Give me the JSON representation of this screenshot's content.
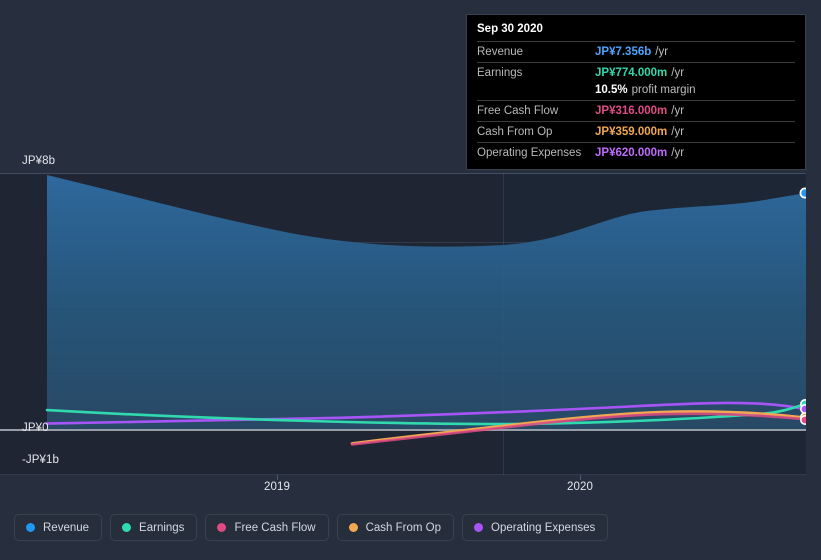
{
  "chart_data": {
    "type": "area",
    "title": "",
    "xlabel": "",
    "ylabel": "",
    "currency": "JP¥",
    "ylim": [
      -1000000000,
      8000000000
    ],
    "yticks": [
      {
        "value": 8000000000,
        "label": "JP¥8b"
      },
      {
        "value": 0,
        "label": "JP¥0"
      },
      {
        "value": -1000000000,
        "label": "-JP¥1b"
      }
    ],
    "xticks": [
      {
        "label": "2019",
        "pos": 277
      },
      {
        "label": "2020",
        "pos": 580
      }
    ],
    "grid": true,
    "legend_position": "bottom",
    "series": [
      {
        "name": "Revenue",
        "color": "#2196f3",
        "filled": true,
        "x": [
          0,
          0.14,
          0.28,
          0.42,
          0.5,
          0.6,
          0.68,
          0.76,
          0.85,
          0.93,
          1.0
        ],
        "values": [
          8050,
          7500,
          6950,
          6500,
          6380,
          6450,
          6800,
          7000,
          7020,
          7100,
          7356
        ],
        "unit": "million JP¥",
        "end_value": 7356
      },
      {
        "name": "Earnings",
        "color": "#31d9ae",
        "filled": false,
        "x": [
          0,
          0.25,
          0.5,
          0.7,
          0.85,
          1.0
        ],
        "values": [
          590,
          430,
          290,
          300,
          500,
          774
        ],
        "unit": "million JP¥",
        "end_value": 774
      },
      {
        "name": "Free Cash Flow",
        "color": "#e04a85",
        "filled": false,
        "x": [
          0.4,
          0.55,
          0.7,
          0.85,
          1.0
        ],
        "values": [
          -480,
          -60,
          330,
          420,
          316
        ],
        "unit": "million JP¥",
        "end_value": 316
      },
      {
        "name": "Cash From Op",
        "color": "#f0a952",
        "filled": false,
        "x": [
          0.4,
          0.55,
          0.7,
          0.85,
          1.0
        ],
        "values": [
          -450,
          -20,
          380,
          470,
          359
        ],
        "unit": "million JP¥",
        "end_value": 359
      },
      {
        "name": "Operating Expenses",
        "color": "#a855f7",
        "filled": false,
        "x": [
          0,
          0.25,
          0.5,
          0.7,
          0.85,
          1.0
        ],
        "values": [
          170,
          210,
          280,
          380,
          500,
          620
        ],
        "unit": "million JP¥",
        "end_value": 620
      }
    ]
  },
  "tooltip": {
    "title": "Sep 30 2020",
    "rows": [
      {
        "label": "Revenue",
        "value": "JP¥7.356b",
        "suffix": "/yr",
        "color": "#4da3ff"
      },
      {
        "label": "Earnings",
        "value": "JP¥774.000m",
        "suffix": "/yr",
        "color": "#31d9ae"
      },
      {
        "label": "",
        "value": "10.5%",
        "suffix": "profit margin",
        "color": "#ffffff"
      },
      {
        "label": "Free Cash Flow",
        "value": "JP¥316.000m",
        "suffix": "/yr",
        "color": "#e04a85"
      },
      {
        "label": "Cash From Op",
        "value": "JP¥359.000m",
        "suffix": "/yr",
        "color": "#f0a952"
      },
      {
        "label": "Operating Expenses",
        "value": "JP¥620.000m",
        "suffix": "/yr",
        "color": "#c06bff"
      }
    ]
  },
  "legend": {
    "items": [
      {
        "label": "Revenue",
        "color": "#2196f3"
      },
      {
        "label": "Earnings",
        "color": "#31d9ae"
      },
      {
        "label": "Free Cash Flow",
        "color": "#e04a85"
      },
      {
        "label": "Cash From Op",
        "color": "#f0a952"
      },
      {
        "label": "Operating Expenses",
        "color": "#a855f7"
      }
    ]
  },
  "axis": {
    "y_top_label": "JP¥8b",
    "y_zero_label": "JP¥0",
    "y_bottom_label": "-JP¥1b",
    "x_left_label": "2019",
    "x_right_label": "2020"
  }
}
